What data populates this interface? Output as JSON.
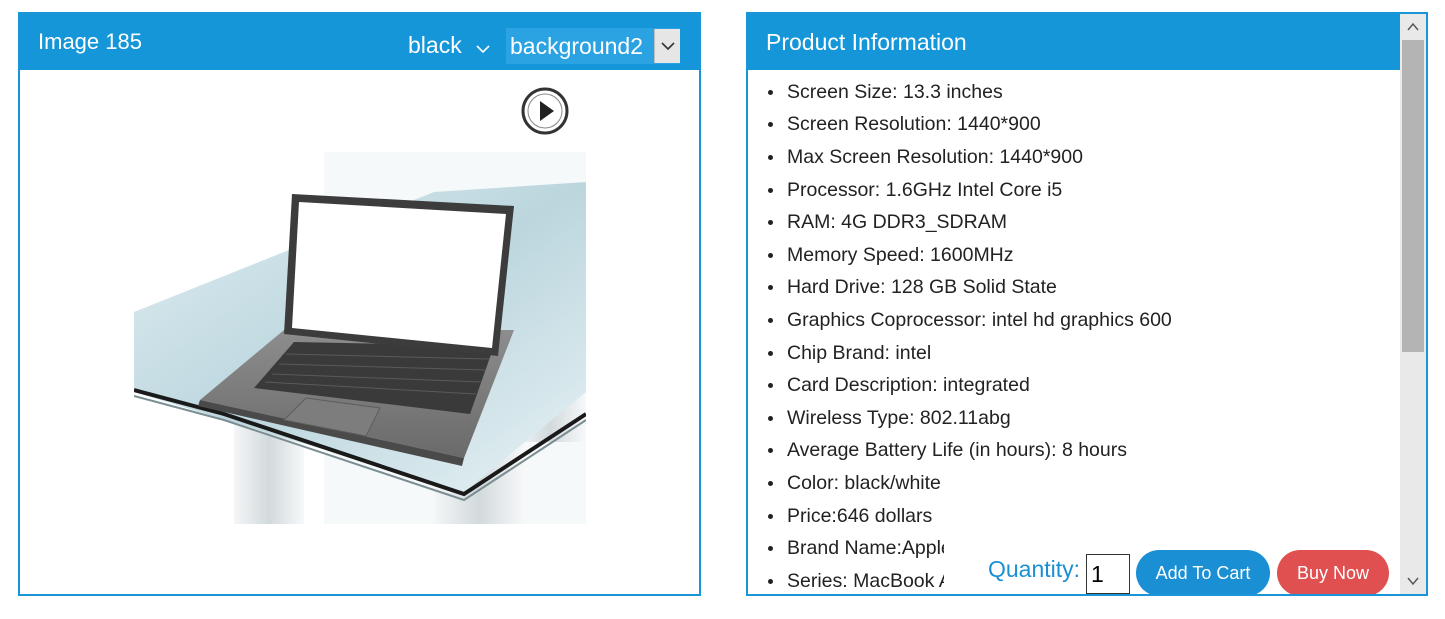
{
  "image_panel": {
    "title": "Image 185",
    "color_select": {
      "selected": "black"
    },
    "background_select": {
      "selected": "background2"
    }
  },
  "info_panel": {
    "title": "Product Information",
    "specs": [
      "Screen Size: 13.3 inches",
      "Screen Resolution: 1440*900",
      "Max Screen Resolution: 1440*900",
      "Processor: 1.6GHz Intel Core i5",
      "RAM: 4G DDR3_SDRAM",
      "Memory Speed: 1600MHz",
      "Hard Drive: 128 GB Solid State",
      "Graphics Coprocessor: intel hd graphics 600",
      "Chip Brand: intel",
      "Card Description: integrated",
      "Wireless Type: 802.11abg",
      "Average Battery Life (in hours): 8 hours",
      "Color: black/white",
      "Price:646 dollars",
      "Brand Name:Apple",
      "Series: MacBook Air"
    ]
  },
  "purchase": {
    "quantity_label": "Quantity:",
    "quantity_value": "1",
    "add_to_cart_label": "Add To Cart",
    "buy_now_label": "Buy Now"
  },
  "colors": {
    "accent": "#1596d8",
    "buy_now": "#e05050"
  }
}
